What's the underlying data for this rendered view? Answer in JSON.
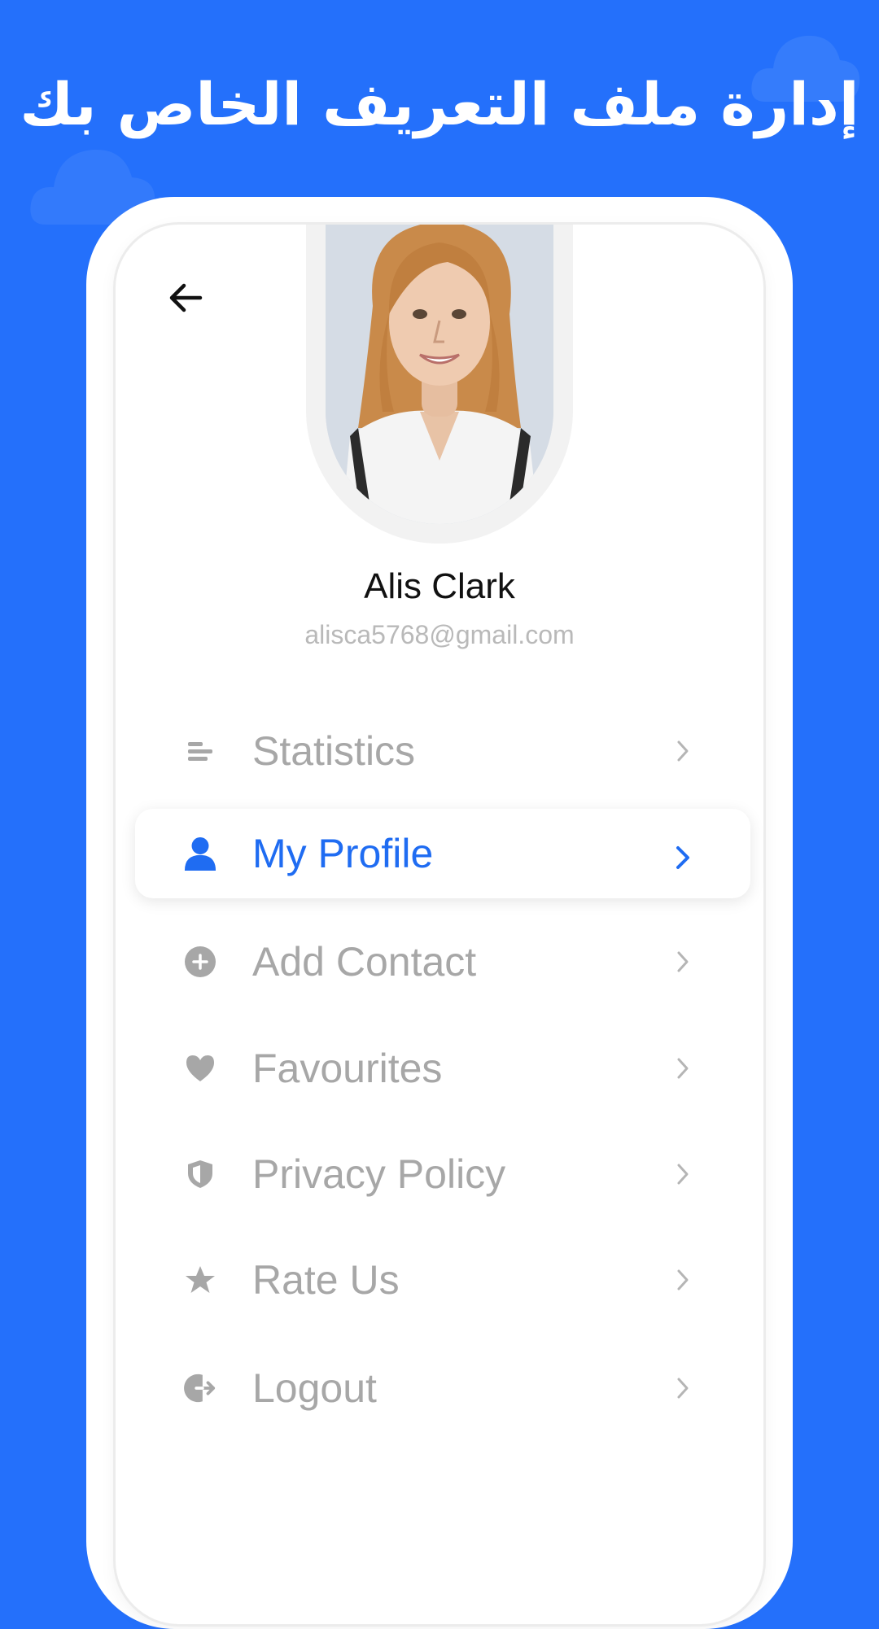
{
  "promo": {
    "headline": "إدارة ملف التعريف الخاص بك",
    "background_color": "#2470fb"
  },
  "header": {
    "back_icon": "arrow-left-icon"
  },
  "profile": {
    "name": "Alis Clark",
    "email": "alisca5768@gmail.com",
    "avatar": "profile-photo"
  },
  "menu": {
    "items": [
      {
        "label": "Statistics",
        "icon": "statistics-icon",
        "active": false
      },
      {
        "label": "My Profile",
        "icon": "user-icon",
        "active": true
      },
      {
        "label": "Add Contact",
        "icon": "add-circle-icon",
        "active": false
      },
      {
        "label": "Favourites",
        "icon": "heart-icon",
        "active": false
      },
      {
        "label": "Privacy Policy",
        "icon": "shield-icon",
        "active": false
      },
      {
        "label": "Rate Us",
        "icon": "star-icon",
        "active": false
      },
      {
        "label": "Logout",
        "icon": "logout-icon",
        "active": false
      }
    ],
    "active_color": "#1f6cf2",
    "inactive_color": "#a7a7a7"
  }
}
